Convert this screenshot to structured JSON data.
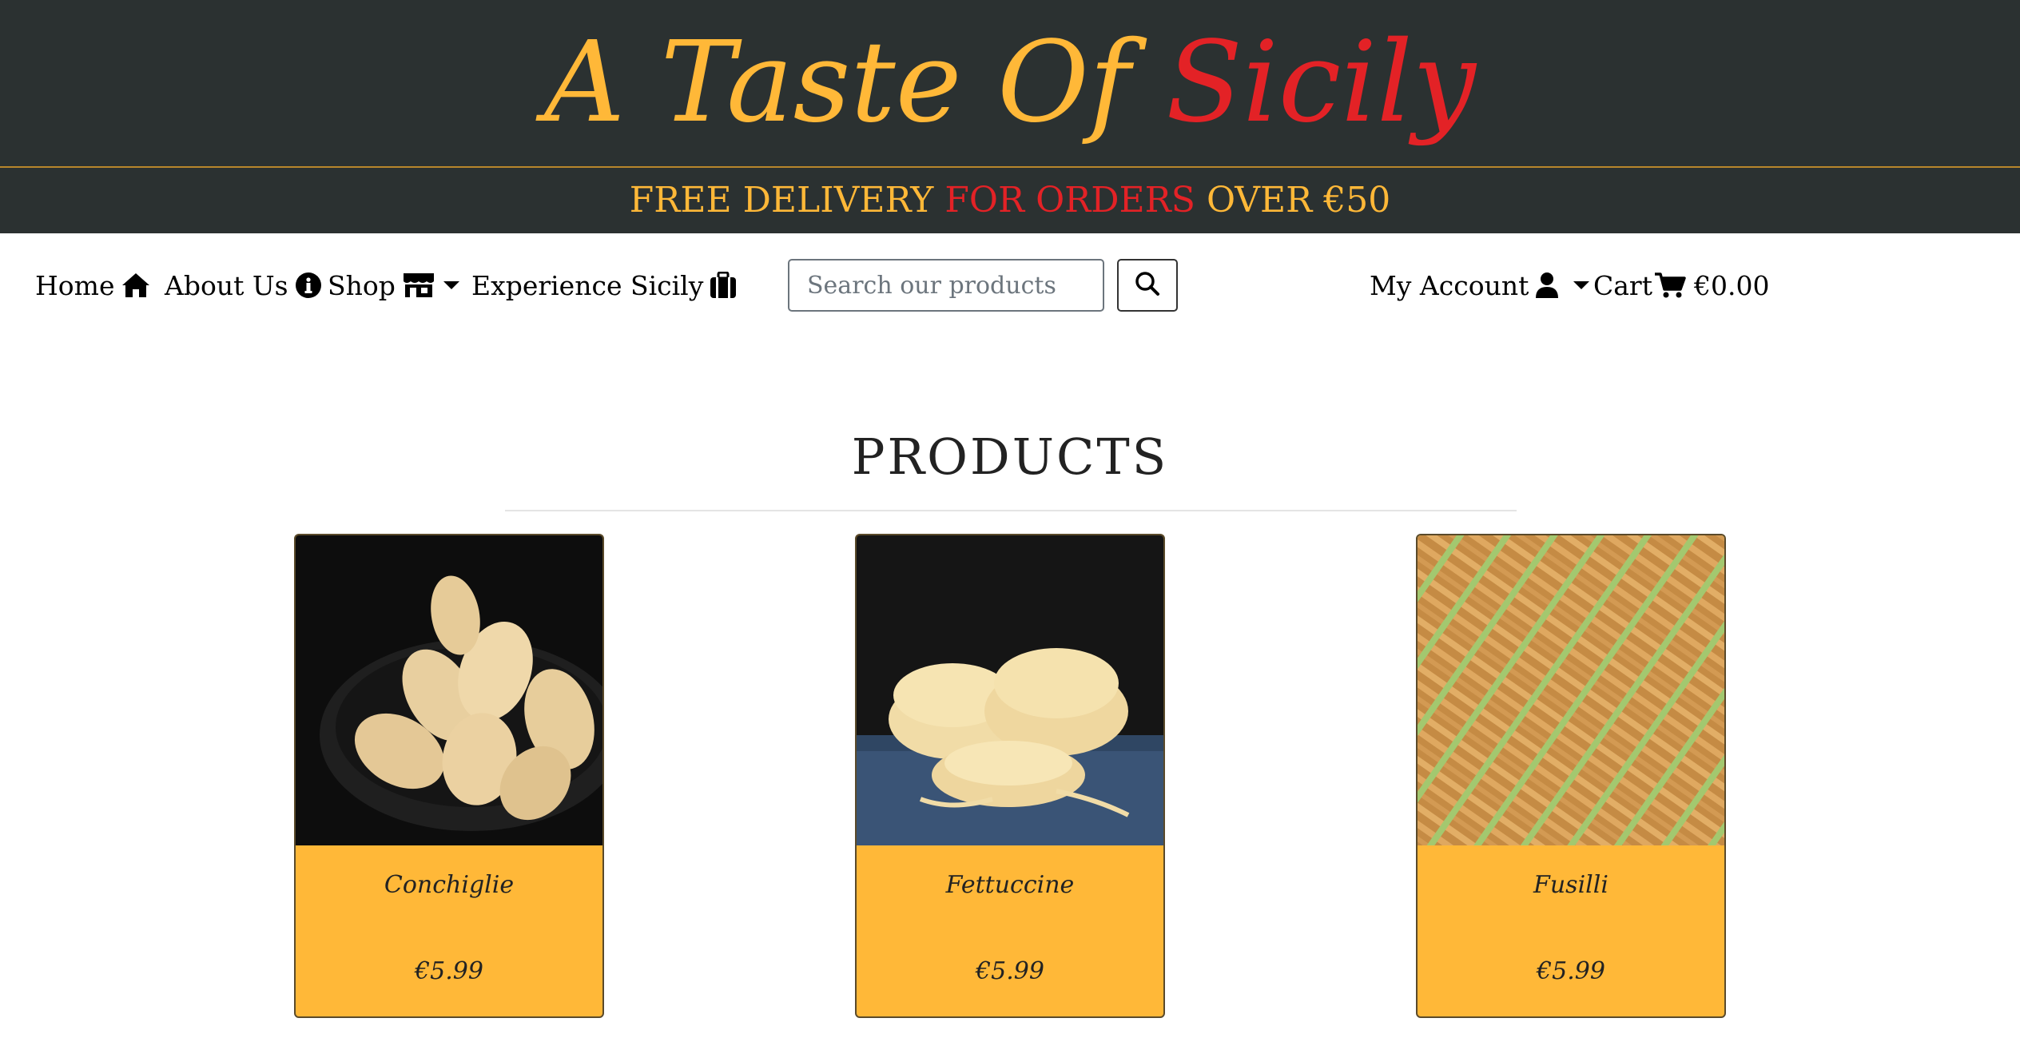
{
  "header": {
    "brand_part1": "A Taste Of",
    "brand_part2": "Sicily",
    "banner_part1": "FREE DELIVERY",
    "banner_part2": "FOR ORDERS",
    "banner_part3": "OVER €50"
  },
  "nav": {
    "home": "Home",
    "about": "About Us",
    "shop": "Shop",
    "experience": "Experience Sicily",
    "account": "My Account",
    "cart_label": "Cart",
    "cart_total": "€0.00"
  },
  "search": {
    "placeholder": "Search our products"
  },
  "main": {
    "heading": "PRODUCTS",
    "products": [
      {
        "name": "Conchiglie",
        "price": "€5.99"
      },
      {
        "name": "Fettuccine",
        "price": "€5.99"
      },
      {
        "name": "Fusilli",
        "price": "€5.99"
      }
    ]
  },
  "colors": {
    "header_bg": "#2b3131",
    "accent_yellow": "#ffb838",
    "accent_red": "#e32226"
  },
  "icons": [
    "home-icon",
    "info-icon",
    "store-icon",
    "suitcase-icon",
    "search-icon",
    "user-icon",
    "cart-icon"
  ]
}
